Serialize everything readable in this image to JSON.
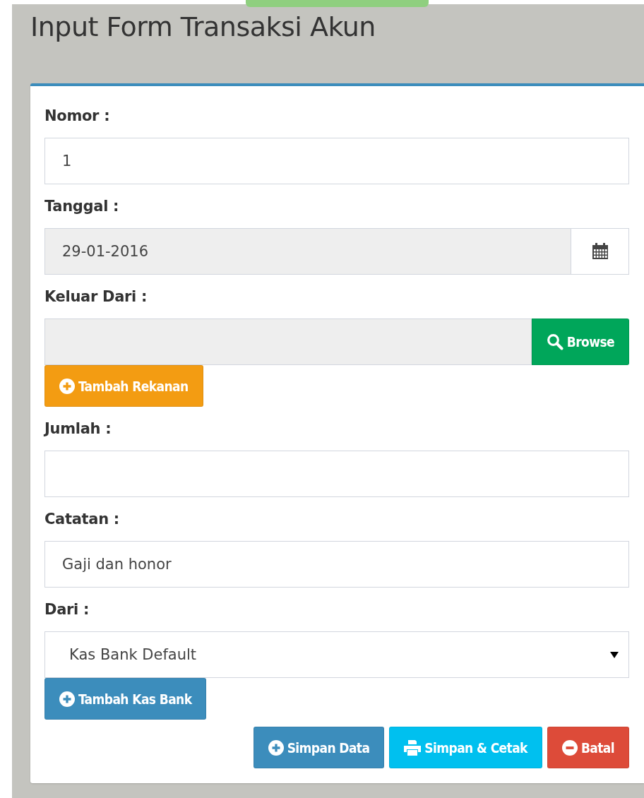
{
  "page": {
    "title": "Input Form Transaksi Akun"
  },
  "fields": [
    {
      "kind": "text",
      "label": "Nomor :",
      "value": "1",
      "readonly": false
    },
    {
      "kind": "date",
      "label": "Tanggal :",
      "value": "29-01-2016",
      "readonly": true
    },
    {
      "kind": "browse",
      "label": "Keluar Dari :",
      "readonly": true,
      "button": {
        "label": "Browse",
        "kind": "success"
      },
      "extra_button": {
        "label": "Tambah Rekanan",
        "kind": "warning"
      }
    },
    {
      "kind": "text",
      "label": "Jumlah :",
      "readonly": false
    },
    {
      "kind": "text",
      "label": "Catatan :",
      "value": "Gaji dan honor",
      "readonly": false
    },
    {
      "kind": "select",
      "label": "Dari :",
      "value": "Kas Bank Default",
      "readonly": false,
      "extra_button": {
        "label": "Tambah Kas Bank",
        "kind": "primary"
      }
    }
  ],
  "actions": [
    {
      "label": "Simpan Data",
      "kind": "primary"
    },
    {
      "label": "Simpan & Cetak",
      "kind": "info"
    },
    {
      "label": "Batal",
      "kind": "danger"
    }
  ]
}
